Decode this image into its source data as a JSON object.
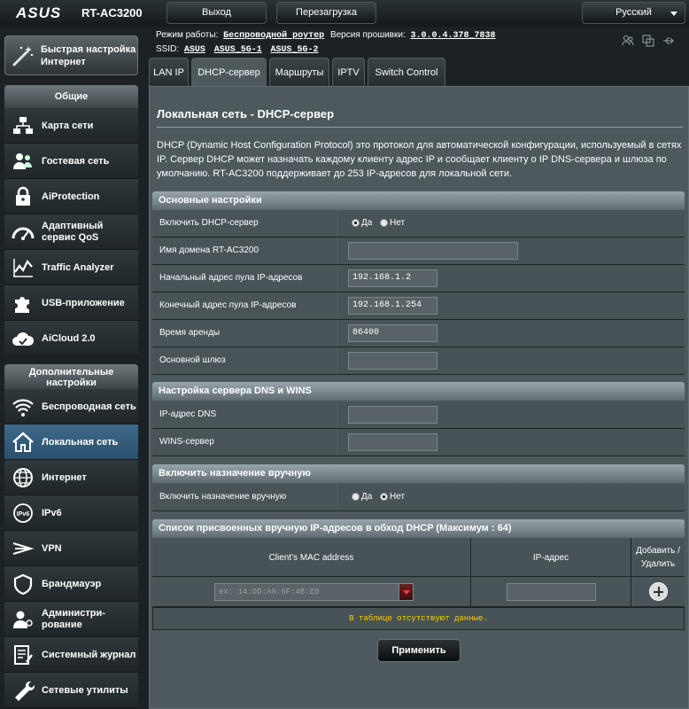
{
  "header": {
    "brand": "ASUS",
    "model": "RT-AC3200",
    "logout_label": "Выход",
    "reboot_label": "Перезагрузка",
    "language": "Русский"
  },
  "status": {
    "mode_label": "Режим работы:",
    "mode_value": "Беспроводной роутер",
    "firmware_label": "Версия прошивки:",
    "firmware_value": "3.0.0.4.378_7838",
    "ssid_label": "SSID:",
    "ssids": [
      "ASUS",
      "ASUS_5G-1",
      "ASUS_5G-2"
    ]
  },
  "sidebar": {
    "quick_setup": "Быстрая настройка Интернет",
    "general_header": "Общие",
    "general_items": [
      {
        "label": "Карта сети",
        "icon": "network-map-icon"
      },
      {
        "label": "Гостевая сеть",
        "icon": "guest-network-icon"
      },
      {
        "label": "AiProtection",
        "icon": "lock-icon"
      },
      {
        "label": "Адаптивный сервис QoS",
        "icon": "gauge-icon"
      },
      {
        "label": "Traffic Analyzer",
        "icon": "chart-icon"
      },
      {
        "label": "USB-приложение",
        "icon": "puzzle-icon"
      },
      {
        "label": "AiCloud 2.0",
        "icon": "cloud-icon"
      }
    ],
    "advanced_header": "Дополнительные настройки",
    "advanced_items": [
      {
        "label": "Беспроводная сеть",
        "icon": "wifi-icon"
      },
      {
        "label": "Локальная сеть",
        "icon": "home-icon",
        "active": true
      },
      {
        "label": "Интернет",
        "icon": "globe-icon"
      },
      {
        "label": "IPv6",
        "icon": "ipv6-icon"
      },
      {
        "label": "VPN",
        "icon": "vpn-icon"
      },
      {
        "label": "Брандмауэр",
        "icon": "shield-icon"
      },
      {
        "label": "Администри-рование",
        "icon": "admin-icon"
      },
      {
        "label": "Системный журнал",
        "icon": "log-icon"
      },
      {
        "label": "Сетевые утилиты",
        "icon": "tools-icon"
      }
    ]
  },
  "tabs": [
    "LAN IP",
    "DHCP-сервер",
    "Маршруты",
    "IPTV",
    "Switch Control"
  ],
  "main": {
    "title": "Локальная сеть - DHCP-сервер",
    "description": "DHCP (Dynamic Host Configuration Protocol) это протокол для автоматической конфигурации, используемый в сетях IP. Сервер DHCP может назначать каждому клиенту адрес IP и сообщает клиенту о IP DNS-сервера и шлюза по умолчанию. RT-AC3200 поддерживает до 253 IP-адресов для локальной сети.",
    "basic": {
      "header": "Основные настройки",
      "enable_label": "Включить DHCP-сервер",
      "yes": "Да",
      "no": "Нет",
      "enable_value": "yes",
      "domain_label": "Имя домена RT-AC3200",
      "domain_value": "",
      "start_label": "Начальный адрес пула IP-адресов",
      "start_value": "192.168.1.2",
      "end_label": "Конечный адрес пула IP-адресов",
      "end_value": "192.168.1.254",
      "lease_label": "Время аренды",
      "lease_value": "86400",
      "gateway_label": "Основной шлюз",
      "gateway_value": ""
    },
    "dns": {
      "header": "Настройка сервера DNS и WINS",
      "dns_label": "IP-адрес DNS",
      "dns_value": "",
      "wins_label": "WINS-сервер",
      "wins_value": ""
    },
    "manual": {
      "header": "Включить назначение вручную",
      "enable_label": "Включить назначение вручную",
      "yes": "Да",
      "no": "Нет",
      "enable_value": "no"
    },
    "manual_list": {
      "header": "Список присвоенных вручную IP-адресов в обход DHCP (Максимум : 64)",
      "col_mac": "Client's MAC address",
      "col_ip": "IP-адрес",
      "col_action": "Добавить / Удалить",
      "mac_placeholder": "ex: 14:DD:A9:6F:4B:E0",
      "empty_text": "В таблице отсутствуют данные."
    },
    "apply_label": "Применить"
  }
}
